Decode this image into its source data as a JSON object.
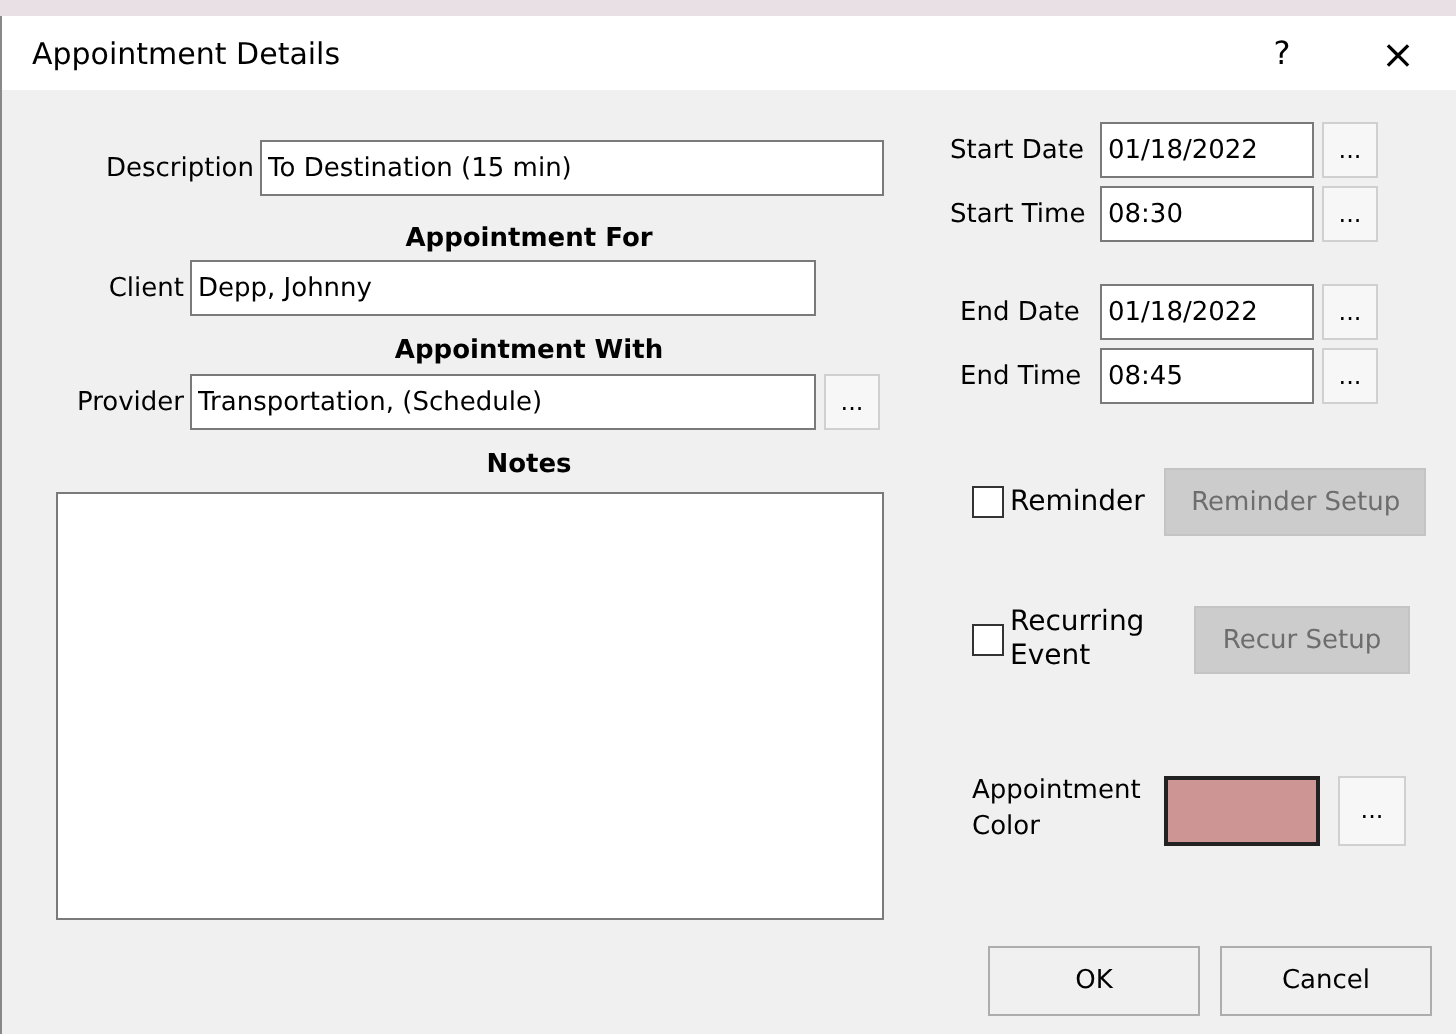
{
  "window": {
    "title": "Appointment Details",
    "help": "?",
    "close": "×"
  },
  "description": {
    "label": "Description",
    "value": "To Destination (15 min)"
  },
  "appointment_for": {
    "heading": "Appointment For",
    "label": "Client",
    "value": "Depp, Johnny"
  },
  "appointment_with": {
    "heading": "Appointment With",
    "label": "Provider",
    "value": "Transportation, (Schedule)",
    "button": "..."
  },
  "notes": {
    "heading": "Notes"
  },
  "date_fields": [
    {
      "label": "Start Date",
      "value": "01/18/2022",
      "button": "..."
    },
    {
      "label": "Start Time",
      "value": "08:30",
      "button": "..."
    },
    {
      "label": "End Date",
      "value": "01/18/2022",
      "button": "..."
    },
    {
      "label": "End Time",
      "value": "08:45",
      "button": "..."
    }
  ],
  "options": [
    {
      "label": "Reminder",
      "checked": false,
      "button": "Reminder Setup",
      "button_disabled": true
    },
    {
      "label": "Recurring Event",
      "checked": false,
      "button": "Recur Setup",
      "button_disabled": true
    }
  ],
  "appointment_color": {
    "label": "Appointment Color",
    "color": "#cd9694",
    "button": "..."
  },
  "buttons": [
    "OK",
    "Cancel"
  ]
}
